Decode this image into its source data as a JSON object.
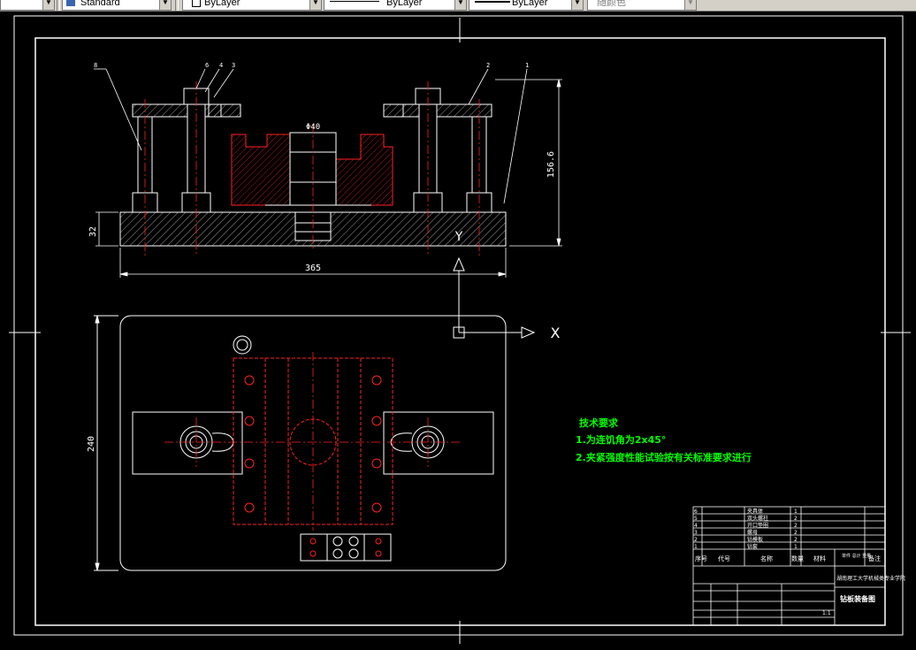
{
  "toolbar": {
    "text_style": "Standard",
    "layer_dropdowns": [
      "ByLayer",
      "ByLayer",
      "ByLayer"
    ],
    "color": "随颜色"
  },
  "drawing": {
    "front_view": {
      "dim_width": "365",
      "dim_height": "32",
      "dim_total_height": "156.6",
      "dim_bore": "Φ40",
      "balloons": [
        "8",
        "6",
        "4",
        "3",
        "2",
        "1"
      ]
    },
    "top_view": {
      "dim_height": "240"
    },
    "ucs": {
      "x_label": "X",
      "y_label": "Y"
    },
    "technical_requirements": {
      "title": "技术要求",
      "item1": "1.为连饥角为2x45°",
      "item2": "2.夹紧强度性能试验按有关标准要求进行"
    },
    "title_block": {
      "school": "湖南理工大学机械类专业学院",
      "drawing_name": "钻板装备图",
      "col_seq": "序号",
      "col_code": "代号",
      "col_name": "名称",
      "col_qty": "数量",
      "col_material": "材料",
      "col_weight": "单件 总计 重量",
      "col_remark": "备注",
      "scale": "1:1",
      "bom_rows": [
        {
          "no": "1",
          "name": "钻套",
          "qty": "1"
        },
        {
          "no": "2",
          "name": "钻模板",
          "qty": "2"
        },
        {
          "no": "3",
          "name": "螺母",
          "qty": "2"
        },
        {
          "no": "4",
          "name": "开口垫圈",
          "qty": "2"
        },
        {
          "no": "5",
          "name": "双头螺柱",
          "qty": "2"
        },
        {
          "no": "6",
          "name": "夹具体",
          "qty": "1"
        }
      ]
    }
  },
  "colors": {
    "background": "#000000",
    "line": "#ffffff",
    "hidden": "#ff0000",
    "text_green": "#00ff00",
    "toolbar": "#d4d0c8"
  }
}
